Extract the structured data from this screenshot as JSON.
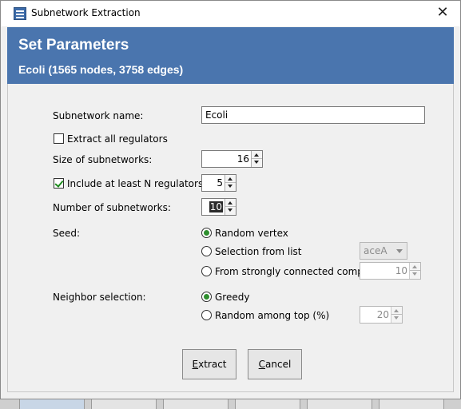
{
  "window": {
    "title": "Subnetwork Extraction",
    "close_glyph": "✕"
  },
  "banner": {
    "title": "Set Parameters",
    "subtitle": "Ecoli (1565 nodes, 3758 edges)"
  },
  "form": {
    "subnetwork_name": {
      "label": "Subnetwork name:",
      "value": "Ecoli"
    },
    "extract_all": {
      "label": "Extract all regulators",
      "checked": false
    },
    "size": {
      "label": "Size of subnetworks:",
      "value": "16"
    },
    "include_n": {
      "label": "Include at least N regulators",
      "checked": true,
      "value": "5"
    },
    "num_subnetworks": {
      "label": "Number of subnetworks:",
      "value": "10"
    },
    "seed": {
      "label": "Seed:",
      "options": [
        {
          "label": "Random vertex",
          "selected": true
        },
        {
          "label": "Selection from list",
          "selected": false
        },
        {
          "label": "From strongly connected comp.",
          "selected": false
        }
      ],
      "list_select": {
        "value": "aceA"
      },
      "scc_value": "10"
    },
    "neighbor": {
      "label": "Neighbor selection:",
      "options": [
        {
          "label": "Greedy",
          "selected": true
        },
        {
          "label": "Random among top (%)",
          "selected": false
        }
      ],
      "top_value": "20"
    }
  },
  "buttons": {
    "extract": {
      "mnemonic": "E",
      "rest": "xtract"
    },
    "cancel": {
      "mnemonic": "C",
      "rest": "ancel"
    }
  },
  "icons": {
    "app": "network-icon",
    "close": "close-icon"
  }
}
